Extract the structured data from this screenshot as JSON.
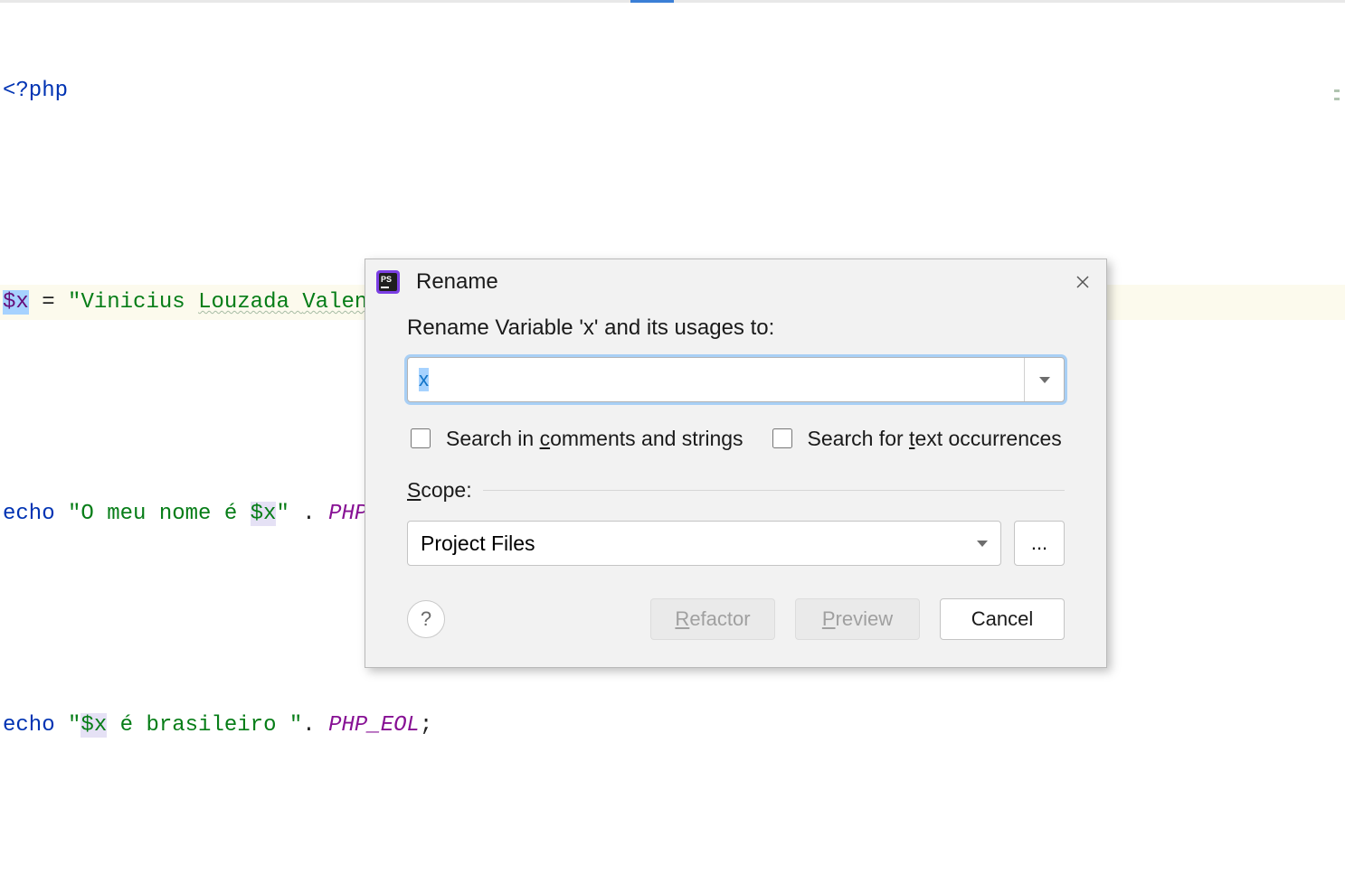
{
  "editor": {
    "line1": {
      "open": "<?php"
    },
    "line3": {
      "var": "$x",
      "assign": " = ",
      "q1": "\"",
      "name1": "Vinicius ",
      "name2": "Louzada ",
      "name3": "Valente",
      "q2": "\"",
      "semi": ";"
    },
    "line5": {
      "echo": "echo ",
      "str_pre": "\"O meu nome é ",
      "var": "$x",
      "str_post": "\"",
      "dot": " . ",
      "const": "PHP_EOL",
      "semi": ";"
    },
    "line7": {
      "echo": "echo ",
      "str_pre": "\"",
      "var": "$x",
      "str_mid": " é brasileiro \"",
      "dot": ". ",
      "const": "PHP_EOL",
      "semi": ";"
    }
  },
  "dialog": {
    "title": "Rename",
    "prompt": "Rename Variable 'x' and its usages to:",
    "input_value": "x",
    "check_comments_pre": "Search in ",
    "check_comments_u": "c",
    "check_comments_post": "omments and strings",
    "check_text_pre": "Search for ",
    "check_text_u": "t",
    "check_text_post": "ext occurrences",
    "scope_label_u": "S",
    "scope_label_rest": "cope:",
    "scope_value": "Project Files",
    "more_btn": "...",
    "help": "?",
    "refactor_u": "R",
    "refactor_rest": "efactor",
    "preview_u": "P",
    "preview_rest": "review",
    "cancel": "Cancel"
  }
}
